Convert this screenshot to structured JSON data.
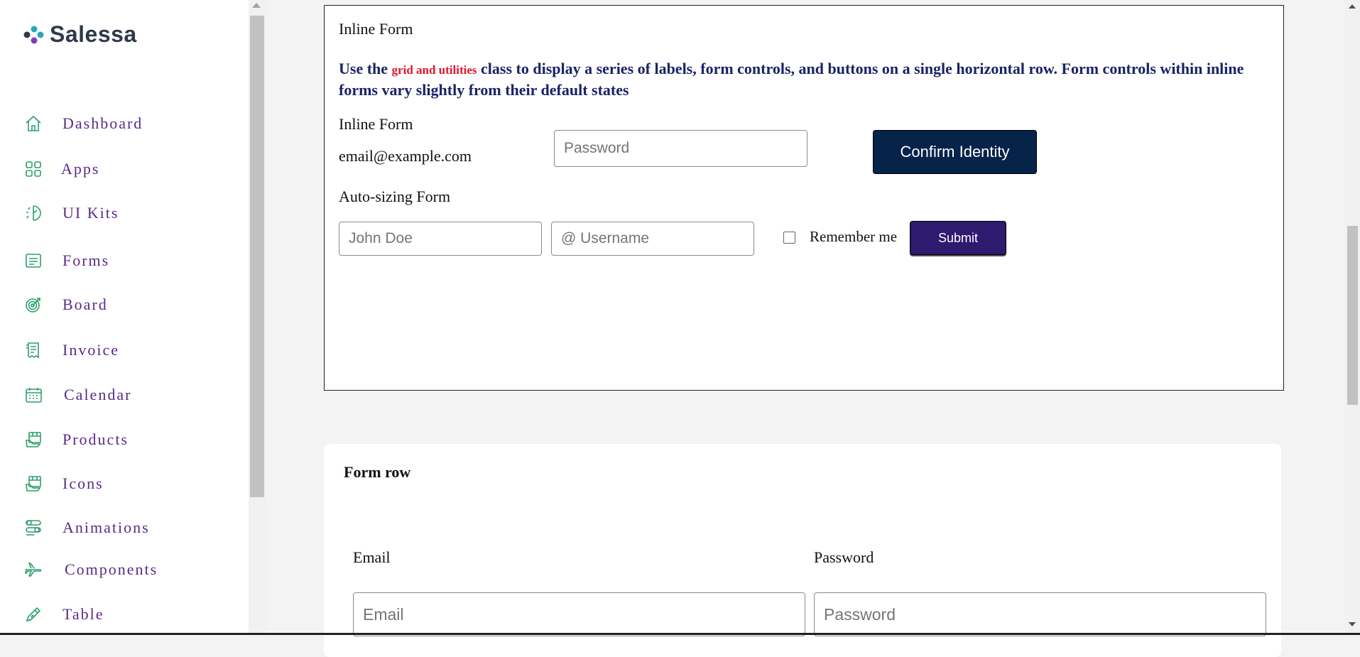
{
  "brand": {
    "name": "Salessa"
  },
  "sidebar": {
    "items": [
      {
        "label": "Dashboard",
        "icon": "home-icon"
      },
      {
        "label": "Apps",
        "icon": "apps-grid-icon"
      },
      {
        "label": "UI Kits",
        "icon": "ui-kits-icon"
      },
      {
        "label": "Forms",
        "icon": "forms-icon"
      },
      {
        "label": "Board",
        "icon": "target-icon"
      },
      {
        "label": "Invoice",
        "icon": "invoice-icon"
      },
      {
        "label": "Calendar",
        "icon": "calendar-icon"
      },
      {
        "label": "Products",
        "icon": "products-icon"
      },
      {
        "label": "Icons",
        "icon": "icons-icon"
      },
      {
        "label": "Animations",
        "icon": "sliders-icon"
      },
      {
        "label": "Components",
        "icon": "plane-icon"
      },
      {
        "label": "Table",
        "icon": "pen-icon"
      }
    ]
  },
  "inline_card": {
    "title": "Inline Form",
    "desc_prefix": "Use the ",
    "desc_highlight": "grid and utilities",
    "desc_suffix": " class to display a series of labels, form controls, and buttons on a single horizontal row. Form controls within inline forms vary slightly from their default states",
    "inline_label": "Inline Form",
    "email_static": "email@example.com",
    "password_placeholder": "Password",
    "confirm_button": "Confirm Identity",
    "autosize_label": "Auto-sizing Form",
    "name_placeholder": "John Doe",
    "username_placeholder": "@ Username",
    "remember_label": "Remember me",
    "submit_button": "Submit"
  },
  "form_row_card": {
    "title": "Form row",
    "email_label": "Email",
    "password_label": "Password",
    "email_placeholder": "Email",
    "password_placeholder": "Password"
  },
  "colors": {
    "nav_text": "#5a2a8a",
    "icon_green": "#2e9e6a",
    "desc_text": "#1a2366",
    "highlight": "#e0162b",
    "confirm_bg": "#06234a",
    "submit_bg": "#2e1a6e"
  }
}
